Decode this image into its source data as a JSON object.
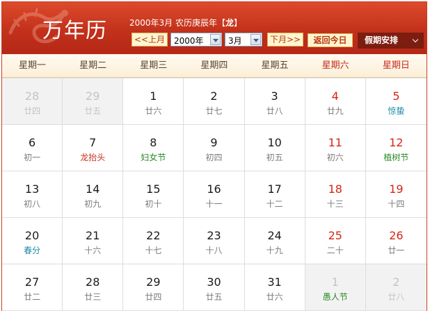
{
  "header": {
    "brand": "万年历",
    "date_info": "2000年3月  农历庚辰年【",
    "zodiac": "龙",
    "date_info_end": "】",
    "prev_month": "<<上月",
    "year_select": "2000年",
    "month_select": "3月",
    "next_month": "下月>>",
    "today": "返回今日",
    "holiday": "假期安排"
  },
  "weekdays": [
    {
      "label": "星期一",
      "weekend": false
    },
    {
      "label": "星期二",
      "weekend": false
    },
    {
      "label": "星期三",
      "weekend": false
    },
    {
      "label": "星期四",
      "weekend": false
    },
    {
      "label": "星期五",
      "weekend": false
    },
    {
      "label": "星期六",
      "weekend": true
    },
    {
      "label": "星期日",
      "weekend": true
    }
  ],
  "days": [
    {
      "day": "28",
      "sub": "廿四",
      "other": true
    },
    {
      "day": "29",
      "sub": "廿五",
      "other": true
    },
    {
      "day": "1",
      "sub": "廿六"
    },
    {
      "day": "2",
      "sub": "廿七"
    },
    {
      "day": "3",
      "sub": "廿八"
    },
    {
      "day": "4",
      "sub": "廿九",
      "weekend": true
    },
    {
      "day": "5",
      "sub": "惊蛰",
      "weekend": true,
      "kind": "term"
    },
    {
      "day": "6",
      "sub": "初一"
    },
    {
      "day": "7",
      "sub": "龙抬头",
      "kind": "folk"
    },
    {
      "day": "8",
      "sub": "妇女节",
      "kind": "fest"
    },
    {
      "day": "9",
      "sub": "初四"
    },
    {
      "day": "10",
      "sub": "初五"
    },
    {
      "day": "11",
      "sub": "初六",
      "weekend": true
    },
    {
      "day": "12",
      "sub": "植树节",
      "weekend": true,
      "kind": "fest"
    },
    {
      "day": "13",
      "sub": "初八"
    },
    {
      "day": "14",
      "sub": "初九"
    },
    {
      "day": "15",
      "sub": "初十"
    },
    {
      "day": "16",
      "sub": "十一"
    },
    {
      "day": "17",
      "sub": "十二"
    },
    {
      "day": "18",
      "sub": "十三",
      "weekend": true
    },
    {
      "day": "19",
      "sub": "十四",
      "weekend": true
    },
    {
      "day": "20",
      "sub": "春分",
      "kind": "term"
    },
    {
      "day": "21",
      "sub": "十六"
    },
    {
      "day": "22",
      "sub": "十七"
    },
    {
      "day": "23",
      "sub": "十八"
    },
    {
      "day": "24",
      "sub": "十九"
    },
    {
      "day": "25",
      "sub": "二十",
      "weekend": true
    },
    {
      "day": "26",
      "sub": "廿一",
      "weekend": true
    },
    {
      "day": "27",
      "sub": "廿二"
    },
    {
      "day": "28",
      "sub": "廿三"
    },
    {
      "day": "29",
      "sub": "廿四"
    },
    {
      "day": "30",
      "sub": "廿五"
    },
    {
      "day": "31",
      "sub": "廿六"
    },
    {
      "day": "1",
      "sub": "愚人节",
      "other": true,
      "kind": "fest"
    },
    {
      "day": "2",
      "sub": "廿八",
      "other": true
    }
  ],
  "colors": {
    "header_red": "#c2311b",
    "weekend_red": "#d42515",
    "solar_term_blue": "#1d8aa6",
    "festival_green": "#2a8a28"
  }
}
